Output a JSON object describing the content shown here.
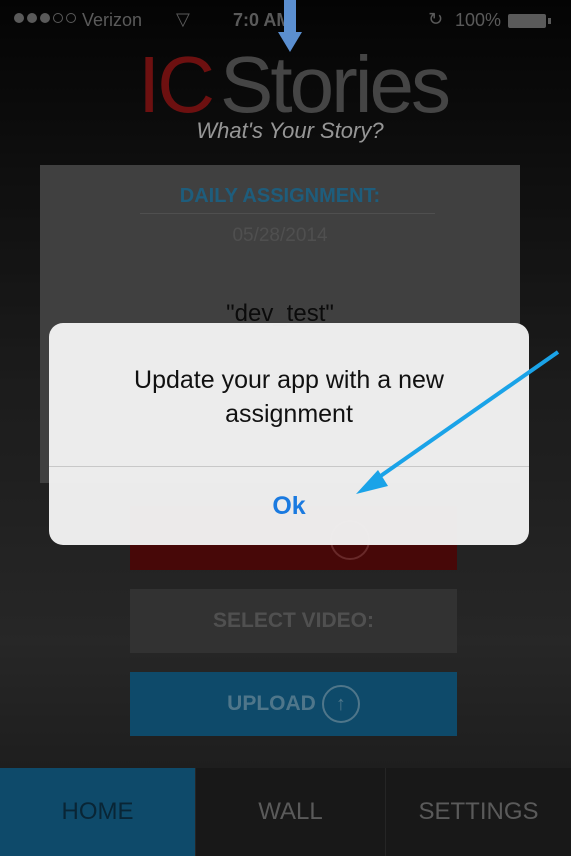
{
  "status_bar": {
    "carrier": "Verizon",
    "time": "7:0 AM",
    "battery": "100%"
  },
  "logo": {
    "ic": "IC",
    "stories": "Stories",
    "tagline": "What's Your Story?"
  },
  "assignment": {
    "title": "DAILY ASSIGNMENT:",
    "date": "05/28/2014",
    "name": "\"dev_test\""
  },
  "buttons": {
    "select_video": "SELECT VIDEO:",
    "upload": "UPLOAD"
  },
  "tabs": [
    {
      "label": "HOME"
    },
    {
      "label": "WALL"
    },
    {
      "label": "SETTINGS"
    }
  ],
  "alert": {
    "message": "Update your app with a new assignment",
    "ok": "Ok"
  },
  "colors": {
    "accent": "#1672a3",
    "brand_red": "#a81a1a",
    "ios_blue": "#1a7ae0",
    "annotation_arrow": "#1aa3e8"
  },
  "icons": {
    "upload": "arrow-up-circle-icon",
    "record": "circle-icon",
    "wifi": "wifi-icon",
    "lock": "rotation-lock-icon"
  }
}
